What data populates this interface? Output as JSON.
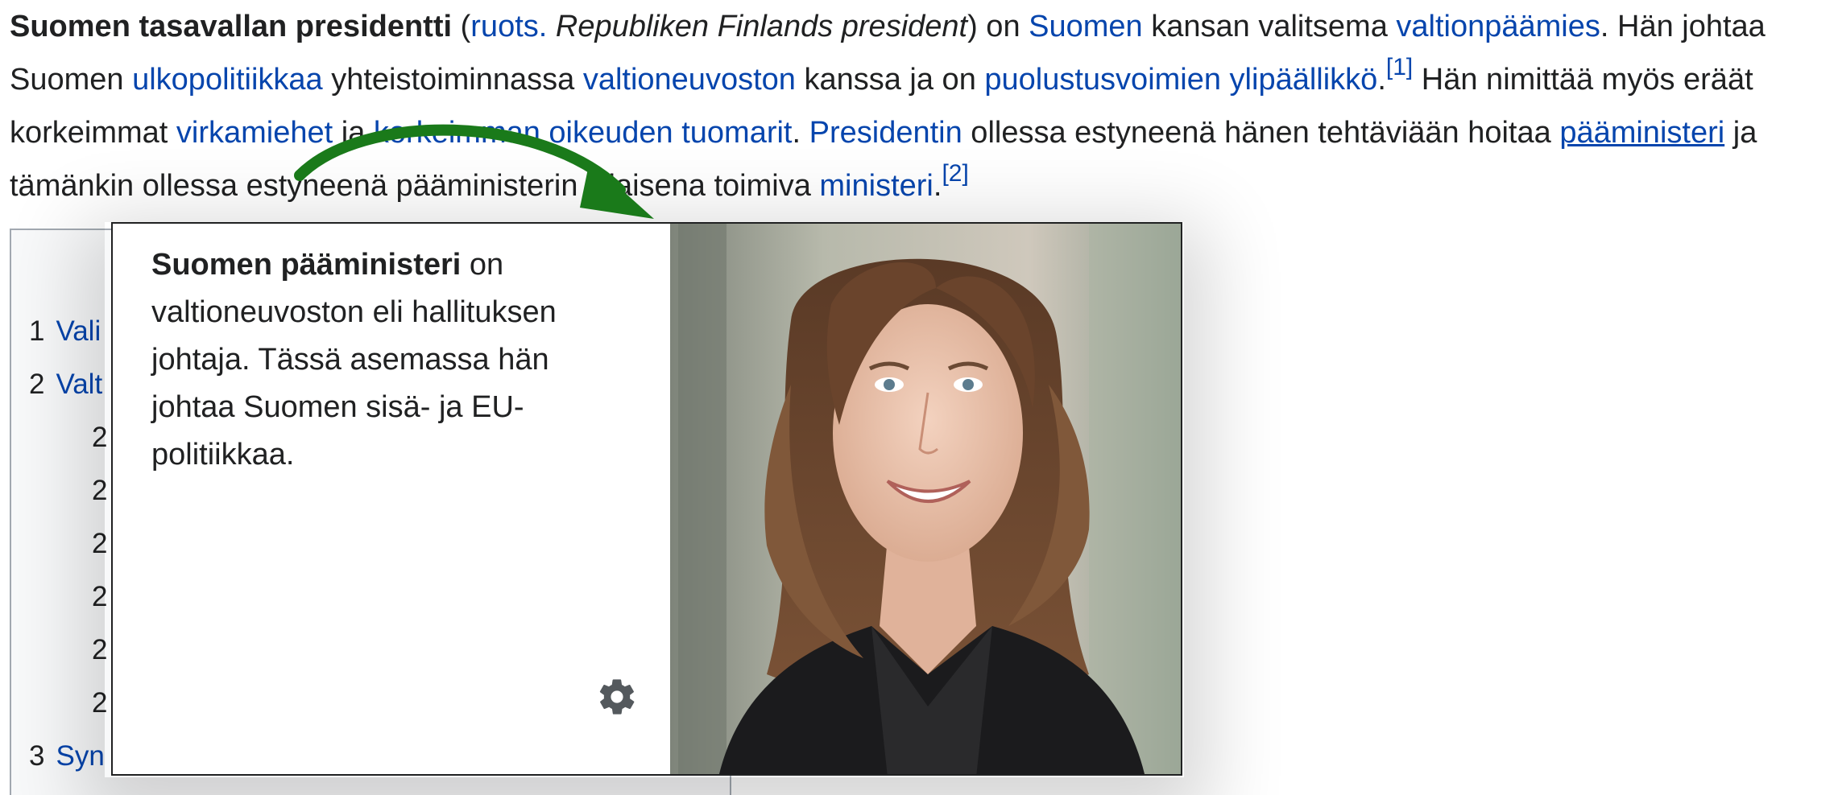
{
  "paragraph": {
    "lead_bold": "Suomen tasavallan presidentti",
    "open_paren": " (",
    "link_ruots": "ruots.",
    "space1": " ",
    "swedish_name": "Republiken Finlands president",
    "close_paren": ") on ",
    "link_suomen": "Suomen",
    "t_kansan": " kansan valitsema ",
    "link_valtionpaamies": "valtionpäämies",
    "t_han_johtaa": ". Hän johtaa Suomen ",
    "link_ulkopolitiikkaa": "ulkopolitiikkaa",
    "t_yhteistoiminnassa": " yhteistoiminnassa ",
    "link_valtioneuvoston": "valtioneuvoston",
    "t_kanssa": " kanssa ja on ",
    "link_puolustusvoimien": "puolustusvoimien ylipäällikkö",
    "t_dot1": ".",
    "ref1": "[1]",
    "t_nimittaa": " Hän nimittää myös eräät korkeimmat ",
    "link_virkamiehet": "virkamiehet",
    "t_ja": " ja ",
    "link_korkeimman": "korkeimman oikeuden tuomarit",
    "t_dot2": ". ",
    "link_presidentin": "Presidentin",
    "t_ollessa": " ollessa estyneenä hänen tehtäviään hoitaa ",
    "link_paaministeri": "pääministeri",
    "t_tamankin": " ja tämänkin ollessa estyneenä pääministerin sijaisena toimiva ",
    "link_ministeri": "ministeri",
    "t_dot3": ".",
    "ref2": "[2]"
  },
  "toc": {
    "items": [
      {
        "num": "1",
        "label": "Vali"
      },
      {
        "num": "2",
        "label": "Valt"
      },
      {
        "num": "2",
        "label": ""
      },
      {
        "num": "2",
        "label": ""
      },
      {
        "num": "2",
        "label": ""
      },
      {
        "num": "2",
        "label": ""
      },
      {
        "num": "2",
        "label": ""
      },
      {
        "num": "2",
        "label": ""
      },
      {
        "num": "3",
        "label": "Syn"
      }
    ]
  },
  "popup": {
    "title_bold": "Suomen pääministeri",
    "body": " on valtioneuvoston eli hallituksen johtaja. Tässä asemassa hän johtaa Suomen sisä- ja EU-politiikkaa.",
    "settings_icon": "gear-icon",
    "image_icon": "portrait-photo"
  },
  "colors": {
    "link": "#0645ad",
    "text": "#202122",
    "arrow": "#1a7a1a",
    "toc_bg": "#f8f9fa"
  }
}
